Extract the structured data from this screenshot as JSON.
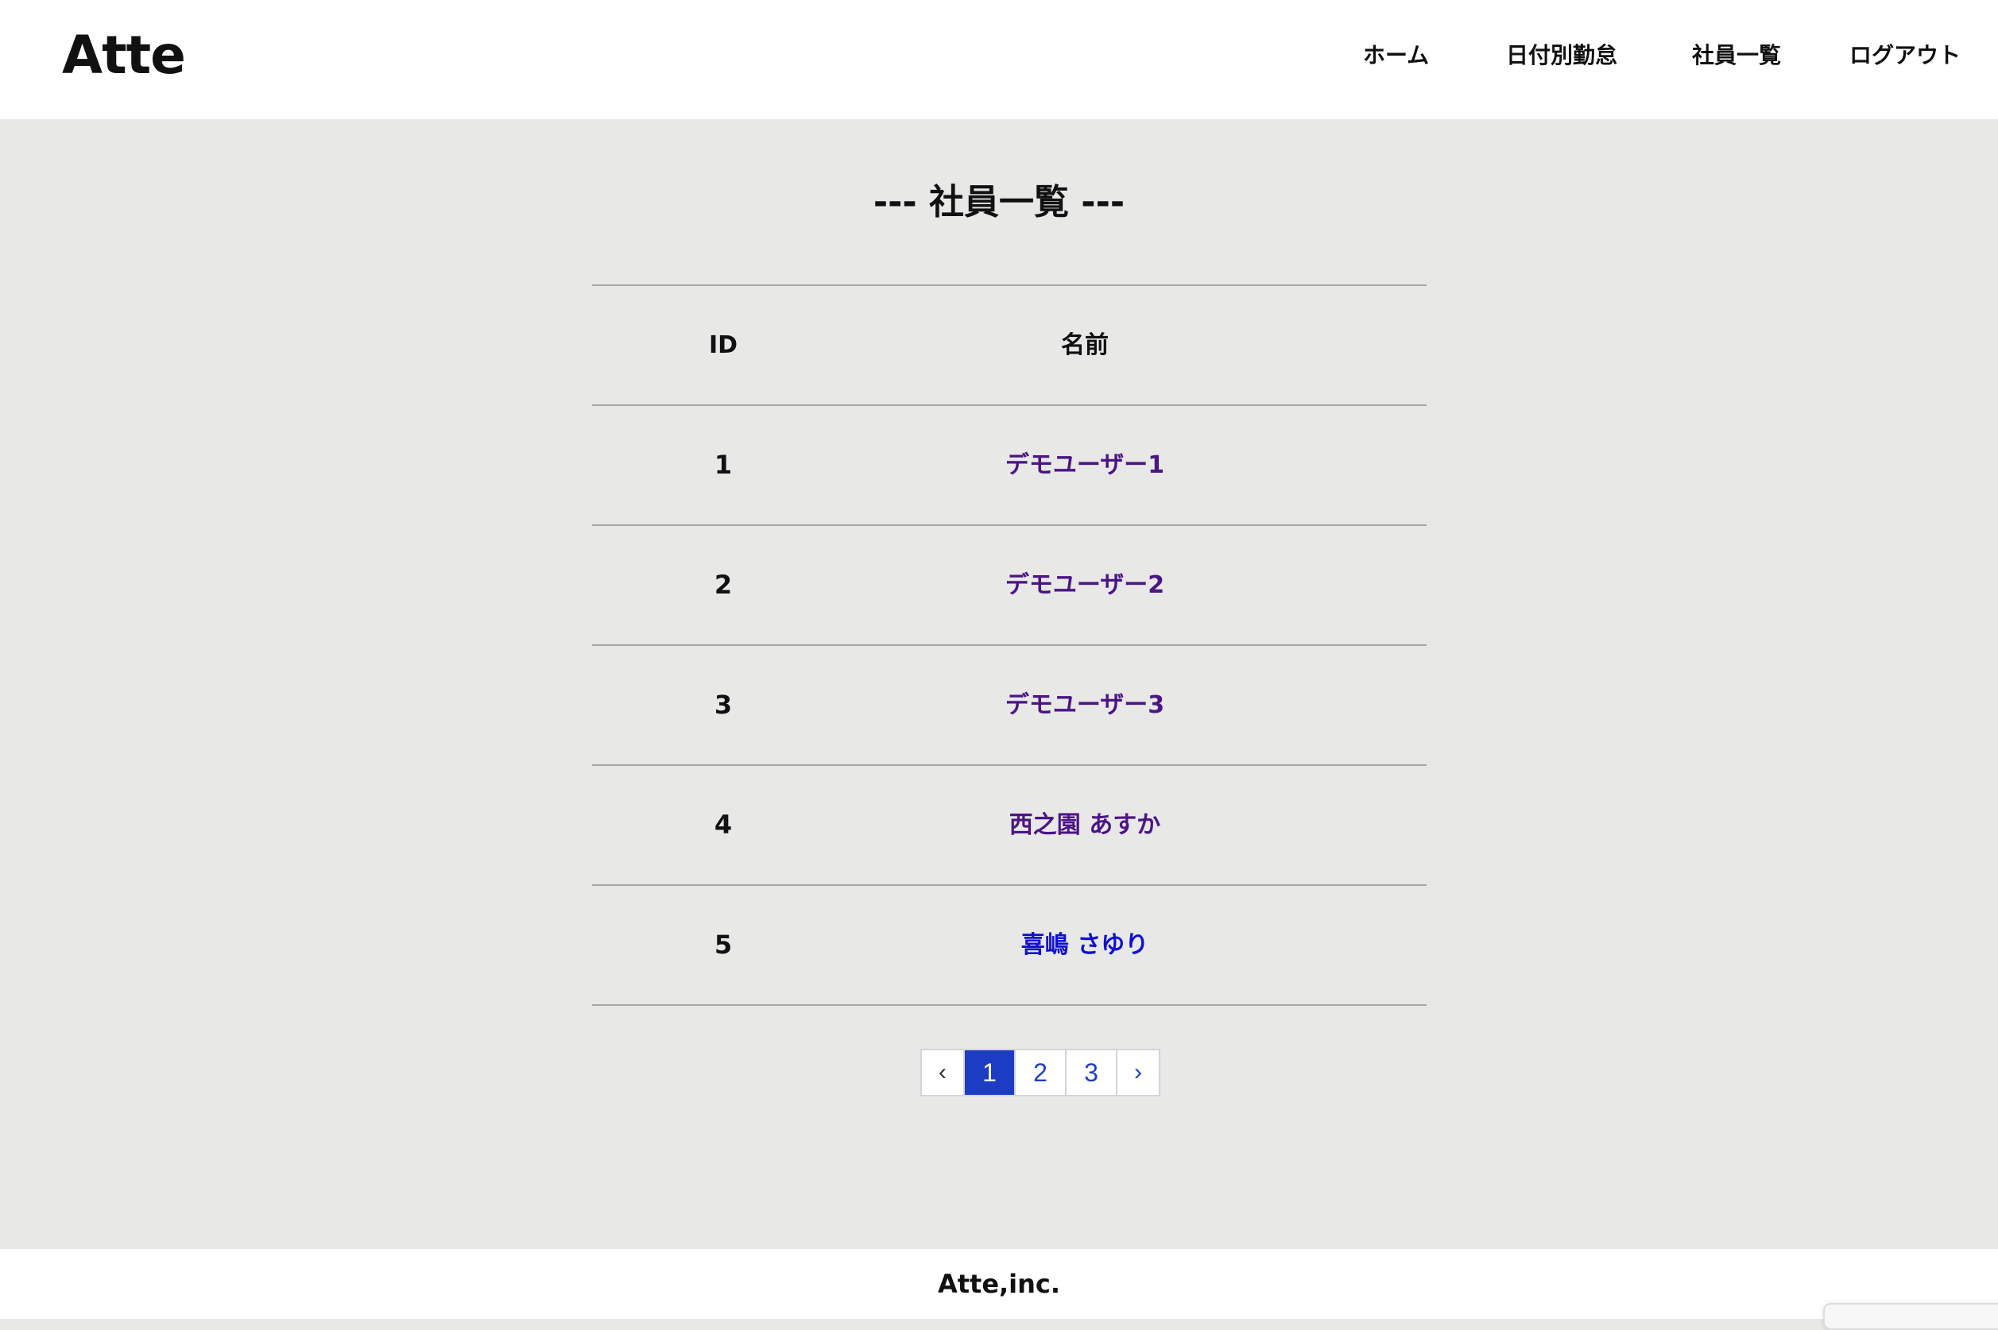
{
  "header": {
    "logo": "Atte",
    "nav": {
      "home": "ホーム",
      "daily_attendance": "日付別勤怠",
      "employee_list": "社員一覧",
      "logout": "ログアウト"
    }
  },
  "main": {
    "title": "--- 社員一覧 ---",
    "table": {
      "columns": {
        "id": "ID",
        "name": "名前"
      },
      "rows": [
        {
          "id": "1",
          "name": "デモユーザー1"
        },
        {
          "id": "2",
          "name": "デモユーザー2"
        },
        {
          "id": "3",
          "name": "デモユーザー3"
        },
        {
          "id": "4",
          "name": "西之園 あすか"
        },
        {
          "id": "5",
          "name": "喜嶋 さゆり"
        }
      ]
    },
    "pagination": {
      "prev": "‹",
      "pages": [
        "1",
        "2",
        "3"
      ],
      "current_page": "1",
      "next": "›"
    }
  },
  "footer": {
    "text": "Atte,inc."
  },
  "colors": {
    "visited_link": "#4b1585",
    "link": "#1010d0",
    "pagination_active": "#1c3cc4",
    "background": "#e8e8e7"
  }
}
